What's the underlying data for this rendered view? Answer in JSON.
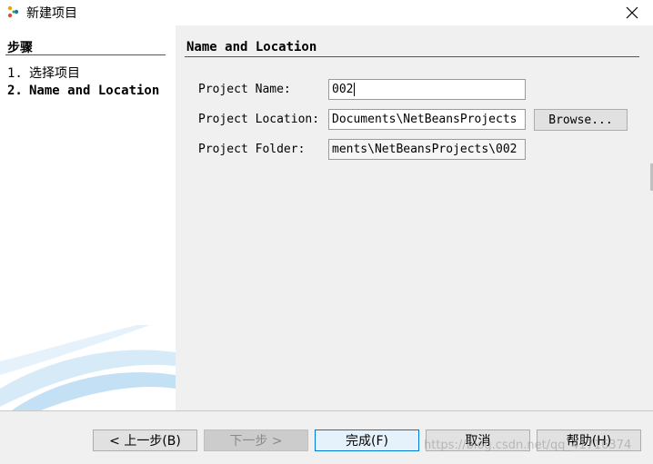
{
  "window": {
    "title": "新建项目",
    "app_icon": "netbeans-cube-icon",
    "close_icon": "close-icon"
  },
  "steps": {
    "heading": "步骤",
    "items": [
      {
        "number": "1.",
        "label": "选择项目",
        "current": false
      },
      {
        "number": "2.",
        "label": "Name and Location",
        "current": true
      }
    ]
  },
  "panel": {
    "heading": "Name and Location",
    "fields": {
      "project_name": {
        "label": "Project Name:",
        "mnemonic": "N",
        "value": "002"
      },
      "project_location": {
        "label": "Project Location:",
        "mnemonic": "L",
        "value": "Documents\\NetBeansProjects"
      },
      "project_folder": {
        "label": "Project Folder:",
        "mnemonic": "F",
        "value": "ments\\NetBeansProjects\\002"
      }
    },
    "browse_label": "Browse..."
  },
  "buttons": {
    "back": "< 上一步(B)",
    "next": "下一步 >",
    "finish": "完成(F)",
    "cancel": "取消",
    "help": "帮助(H)"
  },
  "watermark": "https://blog.csdn.net/qq_41716374",
  "colors": {
    "dialog_bg": "#f0f0f0",
    "accent": "#0078d7",
    "swoosh": "#cfe6f7"
  }
}
